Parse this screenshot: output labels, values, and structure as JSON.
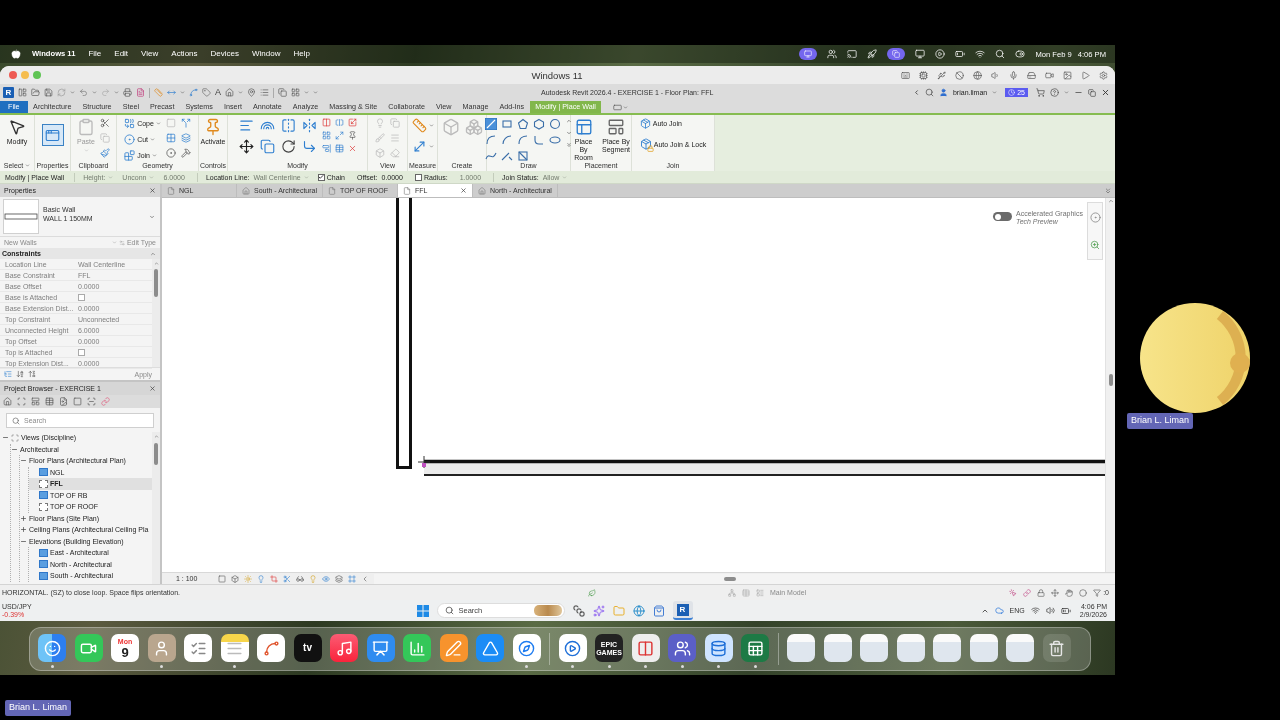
{
  "mac_menu_bar": {
    "app": "Windows 11",
    "menus": [
      "File",
      "Edit",
      "View",
      "Actions",
      "Devices",
      "Window",
      "Help"
    ],
    "date": "Mon Feb 9",
    "time": "4:06 PM"
  },
  "vm_window": {
    "title": "Windows 11"
  },
  "revit": {
    "quick_access": {
      "logo": "R",
      "text_tool": "A"
    },
    "title": "Autodesk Revit 2026.4 - EXERCISE 1 - Floor Plan: FFL",
    "user": "brian.liman",
    "badge": "25",
    "ribbon_tabs": [
      {
        "label": "File",
        "kind": "file",
        "selected": false
      },
      {
        "label": "Architecture",
        "kind": "tab",
        "selected": false
      },
      {
        "label": "Structure",
        "kind": "tab",
        "selected": false
      },
      {
        "label": "Steel",
        "kind": "tab",
        "selected": false
      },
      {
        "label": "Precast",
        "kind": "tab",
        "selected": false
      },
      {
        "label": "Systems",
        "kind": "tab",
        "selected": false
      },
      {
        "label": "Insert",
        "kind": "tab",
        "selected": false
      },
      {
        "label": "Annotate",
        "kind": "tab",
        "selected": false
      },
      {
        "label": "Analyze",
        "kind": "tab",
        "selected": false
      },
      {
        "label": "Massing & Site",
        "kind": "tab",
        "selected": false
      },
      {
        "label": "Collaborate",
        "kind": "tab",
        "selected": false
      },
      {
        "label": "View",
        "kind": "tab",
        "selected": false
      },
      {
        "label": "Manage",
        "kind": "tab",
        "selected": false
      },
      {
        "label": "Add-Ins",
        "kind": "tab",
        "selected": false
      },
      {
        "label": "Modify | Place Wall",
        "kind": "context",
        "selected": true
      }
    ],
    "ribbon_panels": [
      {
        "title": "Select",
        "has_menu": true,
        "tools": [
          {
            "label": "Modify",
            "kind": "large",
            "disabled": false,
            "has_menu": false
          }
        ]
      },
      {
        "title": "Properties",
        "tools": [
          {
            "kind": "toggle",
            "on": true
          }
        ]
      },
      {
        "title": "Clipboard",
        "tools": [
          {
            "label": "Paste",
            "kind": "large",
            "disabled": true,
            "has_menu": true
          }
        ]
      },
      {
        "title": "Geometry",
        "tools": [
          {
            "label": "Cope",
            "kind": "small",
            "disabled": false,
            "has_menu": true
          },
          {
            "label": "Cut",
            "kind": "small",
            "disabled": false,
            "has_menu": true
          },
          {
            "label": "Join",
            "kind": "small",
            "disabled": false,
            "has_menu": true
          }
        ]
      },
      {
        "title": "Controls",
        "tools": [
          {
            "label": "Activate",
            "kind": "large",
            "disabled": false,
            "has_menu": false
          }
        ]
      },
      {
        "title": "Modify"
      },
      {
        "title": "View"
      },
      {
        "title": "Measure"
      },
      {
        "title": "Create"
      },
      {
        "title": "Draw",
        "draw_tools": [
          {
            "selected": true
          },
          {
            "selected": false
          },
          {
            "selected": false
          },
          {
            "selected": false
          },
          {
            "selected": false
          },
          {
            "selected": false
          },
          {
            "selected": false
          },
          {
            "selected": false
          },
          {
            "selected": false
          },
          {
            "selected": false
          },
          {
            "selected": false
          },
          {
            "selected": false
          },
          {
            "selected": false
          }
        ]
      },
      {
        "title": "Placement",
        "tools": [
          {
            "label": "Place By Room",
            "kind": "large",
            "disabled": false,
            "has_menu": false
          },
          {
            "label": "Place By Segment",
            "kind": "large",
            "disabled": false,
            "has_menu": false
          }
        ]
      },
      {
        "title": "Join",
        "tools": [
          {
            "label": "Auto Join",
            "kind": "small",
            "disabled": false,
            "has_menu": false
          },
          {
            "label": "Auto Join & Lock",
            "kind": "small",
            "disabled": false,
            "has_menu": false
          }
        ]
      }
    ],
    "options_bar": {
      "mode": "Modify | Place Wall",
      "items": [
        {
          "kind": "dropdown",
          "label": "Height:",
          "disabled": true
        },
        {
          "kind": "dropdown",
          "label": "Unconn",
          "disabled": true
        },
        {
          "kind": "value",
          "value": "6.0000",
          "disabled": true
        },
        {
          "kind": "select",
          "label": "Location Line:",
          "value": "Wall Centerline",
          "disabled": true
        },
        {
          "kind": "checkbox",
          "label": "Chain",
          "checked": true
        },
        {
          "kind": "field",
          "label": "Offset:",
          "value": "0.0000",
          "disabled": false
        },
        {
          "kind": "checkbox",
          "label": "Radius:",
          "checked": false
        },
        {
          "kind": "value",
          "value": "1.0000",
          "disabled": true
        },
        {
          "kind": "select",
          "label": "Join Status:",
          "value": "Allow",
          "disabled": true
        }
      ]
    },
    "view_tabs": [
      {
        "label": "NGL",
        "kind": "plan",
        "selected": false
      },
      {
        "label": "South - Architectural",
        "kind": "elevation",
        "selected": false
      },
      {
        "label": "TOP OF ROOF",
        "kind": "plan",
        "selected": false
      },
      {
        "label": "FFL",
        "kind": "plan",
        "selected": true
      },
      {
        "label": "North - Architectural",
        "kind": "elevation",
        "selected": false
      }
    ],
    "properties": {
      "title": "Properties",
      "type_family": "Basic Wall",
      "type_name": "WALL 1 150MM",
      "filter": {
        "label": "New Walls",
        "disabled": true
      },
      "edit_type": {
        "label": "Edit Type",
        "disabled": true
      },
      "group": "Constraints",
      "rows": [
        {
          "kind": "text",
          "label": "Location Line",
          "value": "Wall Centerline"
        },
        {
          "kind": "text",
          "label": "Base Constraint",
          "value": "FFL"
        },
        {
          "kind": "text",
          "label": "Base Offset",
          "value": "0.0000"
        },
        {
          "kind": "checkbox",
          "label": "Base is Attached",
          "checked": false
        },
        {
          "kind": "text",
          "label": "Base Extension Dist...",
          "value": "0.0000"
        },
        {
          "kind": "text",
          "label": "Top Constraint",
          "value": "Unconnected"
        },
        {
          "kind": "text",
          "label": "Unconnected Height",
          "value": "6.0000"
        },
        {
          "kind": "text",
          "label": "Top Offset",
          "value": "0.0000"
        },
        {
          "kind": "checkbox",
          "label": "Top is Attached",
          "checked": false
        },
        {
          "kind": "text",
          "label": "Top Extension Dist...",
          "value": "0.0000"
        }
      ],
      "apply": {
        "label": "Apply",
        "disabled": true
      }
    },
    "project_browser": {
      "title": "Project Browser - EXERCISE 1",
      "search_placeholder": "Search",
      "tree": [
        {
          "label": "Views (Discipline)",
          "expanded": true,
          "children": [
            {
              "label": "Architectural",
              "expanded": true,
              "children": [
                {
                  "label": "Floor Plans (Architectural Plan)",
                  "expanded": true,
                  "children": [
                    {
                      "label": "NGL",
                      "selected": false,
                      "on_sheet": true
                    },
                    {
                      "label": "FFL",
                      "selected": true,
                      "on_sheet": false
                    },
                    {
                      "label": "TOP OF RB",
                      "selected": false,
                      "on_sheet": true
                    },
                    {
                      "label": "TOP OF ROOF",
                      "selected": false,
                      "on_sheet": false
                    }
                  ]
                },
                {
                  "label": "Floor Plans (Site Plan)",
                  "expanded": false
                },
                {
                  "label": "Ceiling Plans (Architectural Ceiling Pla",
                  "expanded": false
                },
                {
                  "label": "Elevations (Building Elevation)",
                  "expanded": true,
                  "children": [
                    {
                      "label": "East - Architectural",
                      "selected": false,
                      "on_sheet": true
                    },
                    {
                      "label": "North - Architectural",
                      "selected": false,
                      "on_sheet": true
                    },
                    {
                      "label": "South - Architectural",
                      "selected": false,
                      "on_sheet": true
                    }
                  ]
                }
              ]
            }
          ]
        }
      ]
    },
    "canvas": {
      "graphics_toggle": {
        "label": "Accelerated Graphics",
        "note": "Tech Preview",
        "on": false
      }
    },
    "view_control_bar": {
      "scale": "1 : 100"
    },
    "status_bar": {
      "message": "HORIZONTAL. (SZ) to close loop. Space flips orientation.",
      "workset": {
        "label": "Main Model",
        "disabled": true
      },
      "filter_count": ":0"
    }
  },
  "taskbar": {
    "ticker": {
      "symbol": "USD/JPY",
      "change": "-0.39%"
    },
    "search_placeholder": "Search",
    "apps": [
      {
        "kind": "task-view",
        "active": false
      },
      {
        "kind": "copilot",
        "active": false
      },
      {
        "kind": "file-explorer",
        "active": false
      },
      {
        "kind": "browser",
        "active": false
      },
      {
        "kind": "store",
        "active": false
      },
      {
        "kind": "glyph",
        "glyph": "R",
        "active": true
      }
    ],
    "language": "ENG",
    "time": "4:06 PM",
    "date": "2/9/2026"
  },
  "dock": {
    "pinned": [
      {
        "kind": "smiley",
        "running": true
      },
      {
        "kind": "video",
        "running": false
      },
      {
        "kind": "calendar",
        "top": "Mon",
        "main": "9",
        "running": false
      },
      {
        "kind": "contacts",
        "running": true
      },
      {
        "kind": "list",
        "running": false
      },
      {
        "kind": "notes",
        "running": true
      },
      {
        "kind": "squiggle",
        "running": false
      },
      {
        "kind": "tv",
        "main": "tv",
        "running": false
      },
      {
        "kind": "music",
        "running": false
      },
      {
        "kind": "presentation",
        "running": false
      },
      {
        "kind": "chart",
        "running": false
      },
      {
        "kind": "pen",
        "running": false
      },
      {
        "kind": "triangle",
        "running": false
      },
      {
        "kind": "compass",
        "running": true
      }
    ],
    "open": [
      {
        "kind": "play",
        "running": true
      },
      {
        "kind": "text-logo",
        "top": "EPIC",
        "main": "GAMES",
        "running": true
      },
      {
        "kind": "split-window",
        "running": true
      },
      {
        "kind": "people",
        "running": true
      },
      {
        "kind": "drive",
        "running": true
      },
      {
        "kind": "spreadsheet",
        "running": true
      }
    ],
    "minimized": [
      {
        "kind": "thumbnail"
      },
      {
        "kind": "thumbnail"
      },
      {
        "kind": "thumbnail"
      },
      {
        "kind": "thumbnail"
      },
      {
        "kind": "thumbnail"
      },
      {
        "kind": "thumbnail"
      },
      {
        "kind": "thumbnail"
      },
      {
        "kind": "trash"
      }
    ]
  },
  "video_call": {
    "tile_name": "Brian L. Liman",
    "self_name": "Brian L. Liman"
  }
}
